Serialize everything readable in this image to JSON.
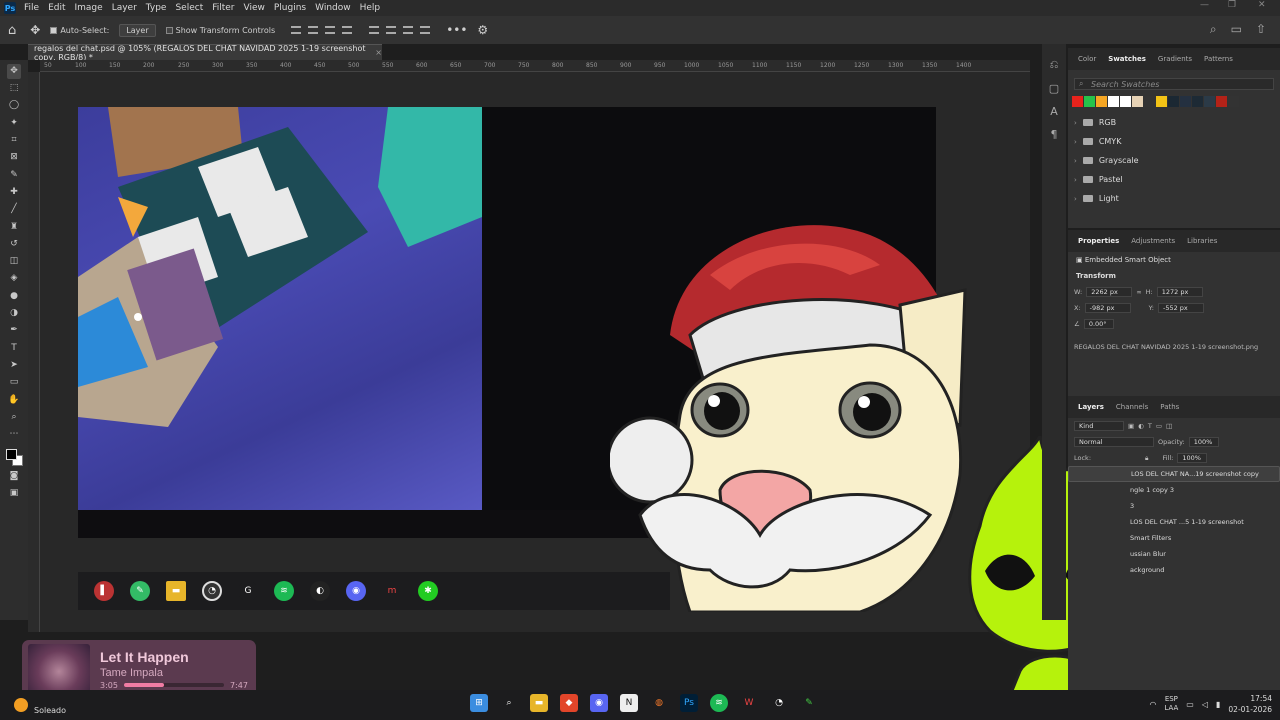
{
  "menubar": {
    "logo": "Ps",
    "items": [
      "File",
      "Edit",
      "Image",
      "Layer",
      "Type",
      "Select",
      "Filter",
      "View",
      "Plugins",
      "Window",
      "Help"
    ]
  },
  "options": {
    "auto_select_label": "Auto-Select:",
    "auto_select_value": "Layer",
    "show_transform_label": "Show Transform Controls"
  },
  "document": {
    "tab_title": "regalos del chat.psd @ 105% (REGALOS DEL CHAT NAVIDAD 2025 1-19 screenshot copy, RGB/8) *"
  },
  "ruler": {
    "ticks": [
      "50",
      "100",
      "150",
      "200",
      "250",
      "300",
      "350",
      "400",
      "450",
      "500",
      "550",
      "600",
      "650",
      "700",
      "750",
      "800",
      "850",
      "900",
      "950",
      "1000",
      "1050",
      "1100",
      "1150",
      "1200",
      "1250",
      "1300",
      "1350",
      "1400"
    ]
  },
  "swatches_panel": {
    "tabs": [
      "Color",
      "Swatches",
      "Gradients",
      "Patterns"
    ],
    "active_tab": "Swatches",
    "search_placeholder": "Search Swatches",
    "colors": [
      "#e8231c",
      "#25c34b",
      "#f5a623",
      "#ffffff",
      "#ffffff",
      "#e6d2b5",
      "#333333",
      "#f3c316",
      "#1b2833",
      "#243040",
      "#1d2a35",
      "#2b3a47",
      "#b32218",
      "#333333"
    ],
    "folders": [
      "RGB",
      "CMYK",
      "Grayscale",
      "Pastel",
      "Light"
    ]
  },
  "properties_panel": {
    "tabs": [
      "Properties",
      "Adjustments",
      "Libraries"
    ],
    "active_tab": "Properties",
    "object_type": "Embedded Smart Object",
    "transform_label": "Transform",
    "w_label": "W:",
    "w_value": "2262 px",
    "h_label": "H:",
    "h_value": "1272 px",
    "x_label": "X:",
    "x_value": "-982 px",
    "y_label": "Y:",
    "y_value": "-552 px",
    "angle_value": "0.00°",
    "filename": "REGALOS DEL CHAT NAVIDAD 2025 1-19 screenshot.png"
  },
  "layers_panel": {
    "tabs": [
      "Layers",
      "Channels",
      "Paths"
    ],
    "active_tab": "Layers",
    "kind_label": "Kind",
    "blend_mode": "Normal",
    "opacity_label": "Opacity:",
    "opacity_value": "100%",
    "lock_label": "Lock:",
    "fill_label": "Fill:",
    "fill_value": "100%",
    "layers": [
      {
        "name": "LOS DEL CHAT NA...19 screenshot copy",
        "selected": true
      },
      {
        "name": "ngle 1 copy 3",
        "selected": false
      },
      {
        "name": "3",
        "selected": false
      },
      {
        "name": "LOS DEL CHAT ...5 1-19 screenshot",
        "selected": false
      },
      {
        "name": "Smart Filters",
        "selected": false
      },
      {
        "name": "ussian Blur",
        "selected": false
      },
      {
        "name": "ackground",
        "selected": false
      }
    ]
  },
  "now_playing": {
    "song": "Let It Happen",
    "artist": "Tame Impala",
    "elapsed": "3:05",
    "duration": "7:47",
    "progress": 0.4
  },
  "taskbar": {
    "weather": "Soleado",
    "lang_top": "ESP",
    "lang_bottom": "LAA",
    "time": "17:54",
    "date": "02-01-2026"
  },
  "canvas": {
    "accent": "#31a8ff",
    "photo_bg": "#4546a8",
    "hat_red": "#c1272d",
    "green_char": "#b6f20c"
  }
}
